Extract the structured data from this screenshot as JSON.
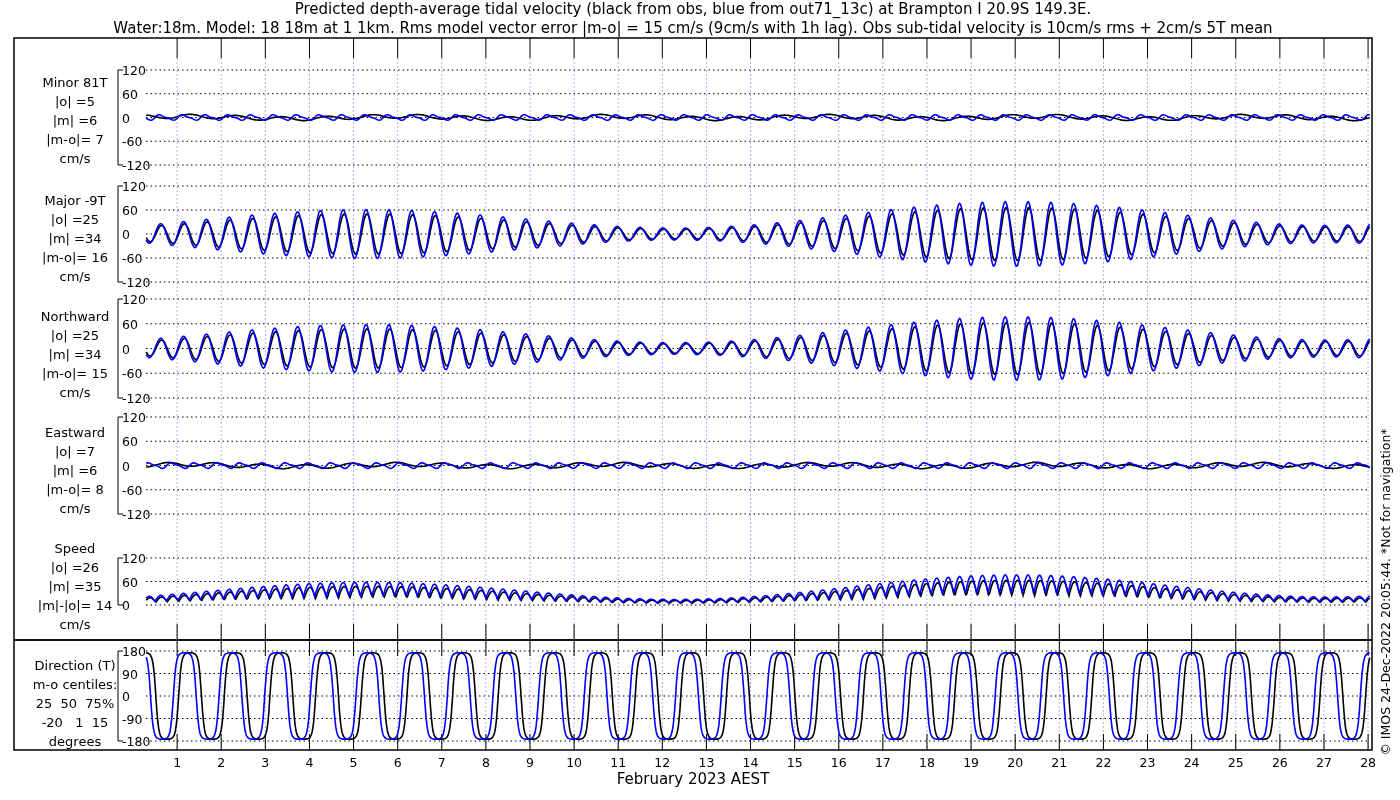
{
  "title": [
    "Predicted depth-average tidal velocity (black from obs, blue from out71_13c) at Brampton I 20.9S 149.3E.",
    "Water:18m. Model: 18 18m at 1 1km. Rms model vector error |m-o| = 15 cm/s (9cm/s with 1h lag). Obs sub-tidal velocity is 10cm/s rms + 2cm/s 5T mean"
  ],
  "panels": [
    {
      "kind": "velocity",
      "labels": [
        "Minor 81T",
        "|o| =5",
        "|m| =6",
        "|m-o|= 7",
        "cm/s"
      ],
      "yticks": [
        "120",
        "60",
        "0",
        "-60",
        "-120"
      ]
    },
    {
      "kind": "velocity",
      "labels": [
        "Major -9T",
        "|o| =25",
        "|m| =34",
        "|m-o|= 16",
        "cm/s"
      ],
      "yticks": [
        "120",
        "60",
        "0",
        "-60",
        "-120"
      ]
    },
    {
      "kind": "velocity",
      "labels": [
        "Northward",
        "|o| =25",
        "|m| =34",
        "|m-o|= 15",
        "cm/s"
      ],
      "yticks": [
        "120",
        "60",
        "0",
        "-60",
        "-120"
      ]
    },
    {
      "kind": "velocity",
      "labels": [
        "Eastward",
        "|o| =7",
        "|m| =6",
        "|m-o|= 8",
        "cm/s"
      ],
      "yticks": [
        "120",
        "60",
        "0",
        "-60",
        "-120"
      ]
    },
    {
      "kind": "speed",
      "labels": [
        "Speed",
        "|o| =26",
        "|m| =35",
        "|m|-|o|= 14",
        "cm/s"
      ],
      "yticks": [
        "120",
        "60",
        "0"
      ]
    },
    {
      "kind": "direction",
      "labels": [
        "Direction (T)",
        "m-o centiles:",
        "25  50  75%",
        "-20   1  15",
        "degrees"
      ],
      "yticks": [
        "180",
        "90",
        "0",
        "-90",
        "-180"
      ]
    }
  ],
  "xticks": [
    "1",
    "2",
    "3",
    "4",
    "5",
    "6",
    "7",
    "8",
    "9",
    "10",
    "11",
    "12",
    "13",
    "14",
    "15",
    "16",
    "17",
    "18",
    "19",
    "20",
    "21",
    "22",
    "23",
    "24",
    "25",
    "26",
    "27",
    "28"
  ],
  "xlabel": "February 2023 AEST",
  "credit": "© IMOS 24-Dec-2022 20:05:44. *Not for navigation*"
}
